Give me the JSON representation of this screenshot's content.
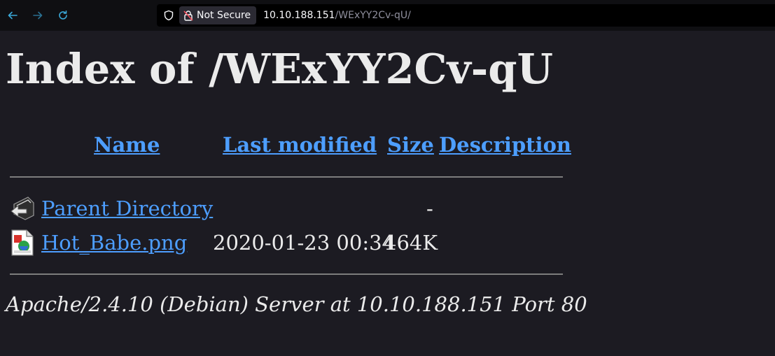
{
  "browser": {
    "security_label": "Not Secure",
    "url_host": "10.10.188.151",
    "url_path": "/WExYY2Cv-qU/",
    "icons": {
      "back": "back-arrow-icon",
      "forward": "forward-arrow-icon",
      "reload": "reload-icon",
      "tracking": "shield-icon",
      "insecure": "lock-warning-icon"
    }
  },
  "page": {
    "title": "Index of /WExYY2Cv-qU",
    "columns": {
      "name": "Name",
      "last_modified": "Last modified",
      "size": "Size",
      "description": "Description"
    },
    "rows": [
      {
        "icon": "back-folder-icon",
        "name": "Parent Directory",
        "last_modified": "",
        "size": "-",
        "description": ""
      },
      {
        "icon": "image-file-icon",
        "name": "Hot_Babe.png",
        "last_modified": "2020-01-23 00:34",
        "size": "464K",
        "description": ""
      }
    ],
    "footer": "Apache/2.4.10 (Debian) Server at 10.10.188.151 Port 80"
  },
  "colors": {
    "link": "#4d9eff",
    "background": "#1c1b22",
    "text": "#ebebeb"
  }
}
